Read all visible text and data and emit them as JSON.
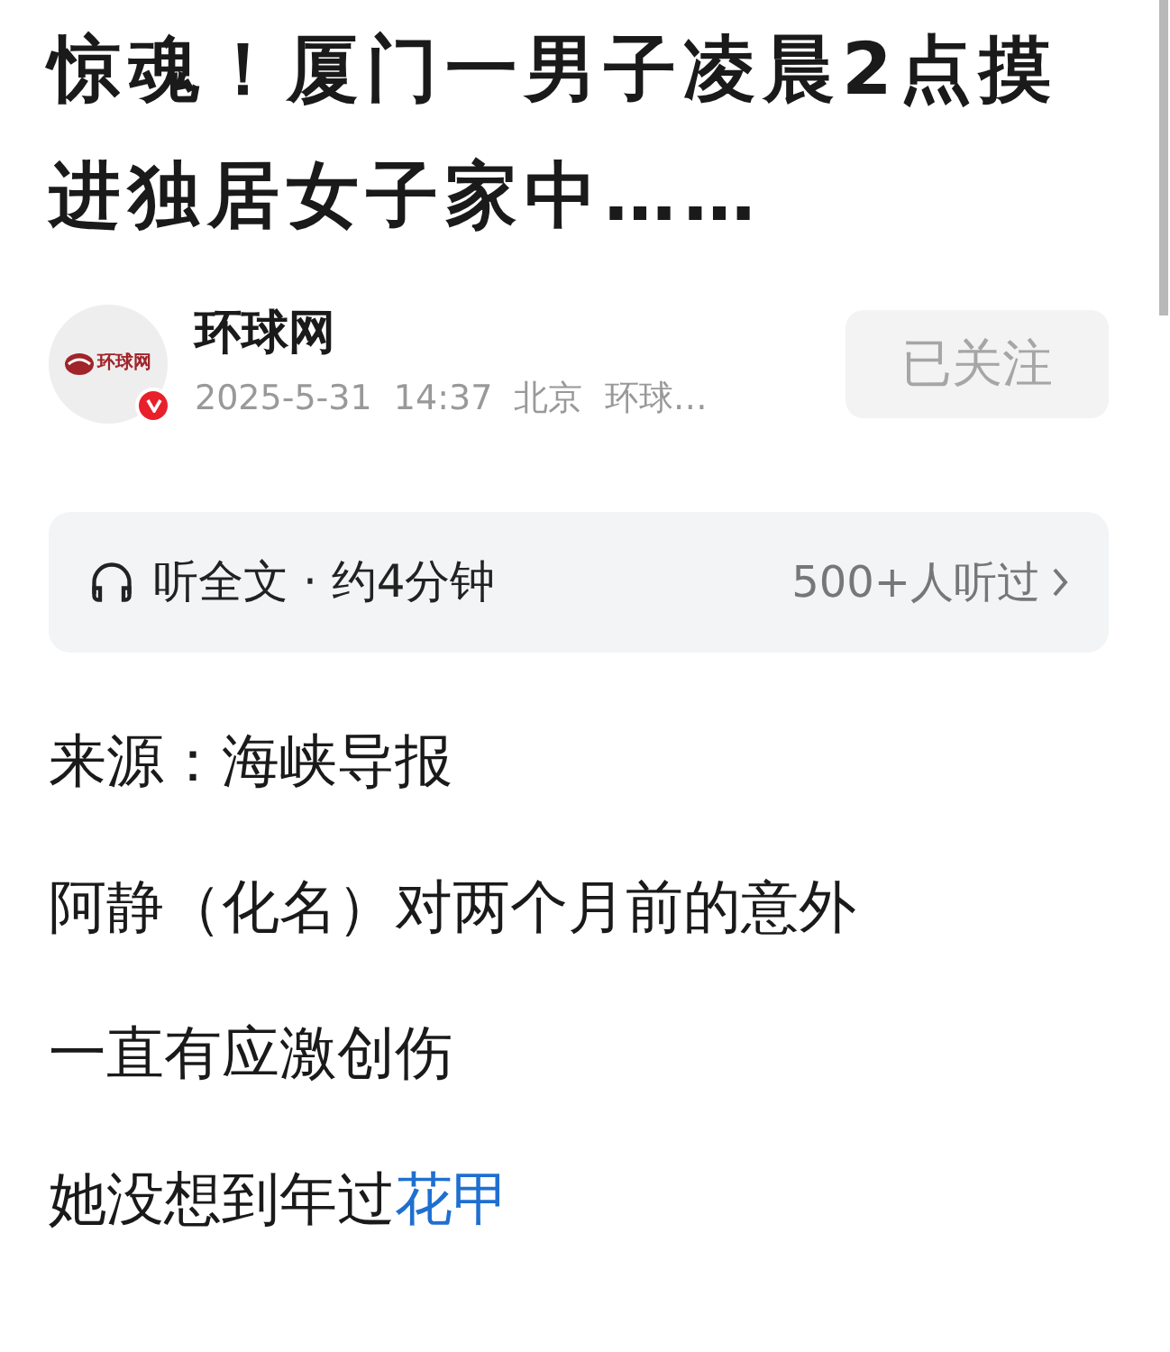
{
  "article": {
    "title": "惊魂！厦门一男子凌晨2点摸进独居女子家中……"
  },
  "author": {
    "avatar_text": "环球网",
    "name": "环球网",
    "verified": true,
    "meta": "2025-5-31  14:37  北京  环球…",
    "follow": {
      "label": "已关注",
      "following": true
    }
  },
  "listen": {
    "label": "听全文 · 约4分钟",
    "count": "500+人听过"
  },
  "paragraphs": [
    {
      "text": "来源：海峡导报"
    },
    {
      "text": "阿静（化名）对两个月前的意外"
    },
    {
      "text": "一直有应激创伤"
    },
    {
      "text": "她没想到年过",
      "link": "花甲"
    }
  ]
}
